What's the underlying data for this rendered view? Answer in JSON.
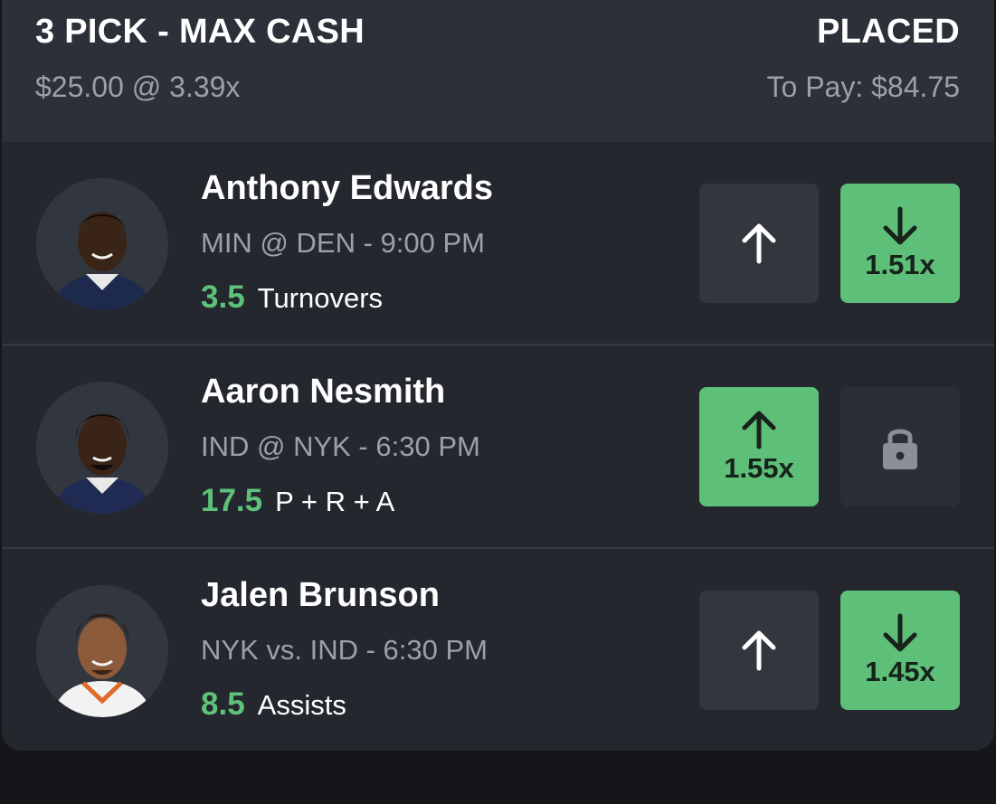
{
  "header": {
    "title": "3 PICK - MAX CASH",
    "status": "PLACED",
    "wager": "$25.00 @ 3.39x",
    "to_pay": "To Pay: $84.75"
  },
  "picks": [
    {
      "name": "Anthony Edwards",
      "matchup": "MIN @ DEN  - 9:00 PM",
      "line": "3.5",
      "stat": "Turnovers",
      "up": {
        "label": "",
        "selected": false,
        "icon": "arrow-up-icon"
      },
      "down": {
        "label": "1.51x",
        "selected": true,
        "icon": "arrow-down-icon"
      }
    },
    {
      "name": "Aaron Nesmith",
      "matchup": "IND @ NYK  - 6:30 PM",
      "line": "17.5",
      "stat": "P + R + A",
      "up": {
        "label": "1.55x",
        "selected": true,
        "icon": "arrow-up-icon"
      },
      "down": {
        "label": "",
        "selected": false,
        "locked": true,
        "icon": "lock-icon"
      }
    },
    {
      "name": "Jalen Brunson",
      "matchup": "NYK vs. IND  - 6:30 PM",
      "line": "8.5",
      "stat": "Assists",
      "up": {
        "label": "",
        "selected": false,
        "icon": "arrow-up-icon"
      },
      "down": {
        "label": "1.45x",
        "selected": true,
        "icon": "arrow-down-icon"
      }
    }
  ],
  "colors": {
    "accent_green": "#5dbf78",
    "line_green": "#5ec27a",
    "card_bg": "#24282e",
    "header_bg": "#2c3038",
    "muted_text": "#9ba1a9"
  }
}
